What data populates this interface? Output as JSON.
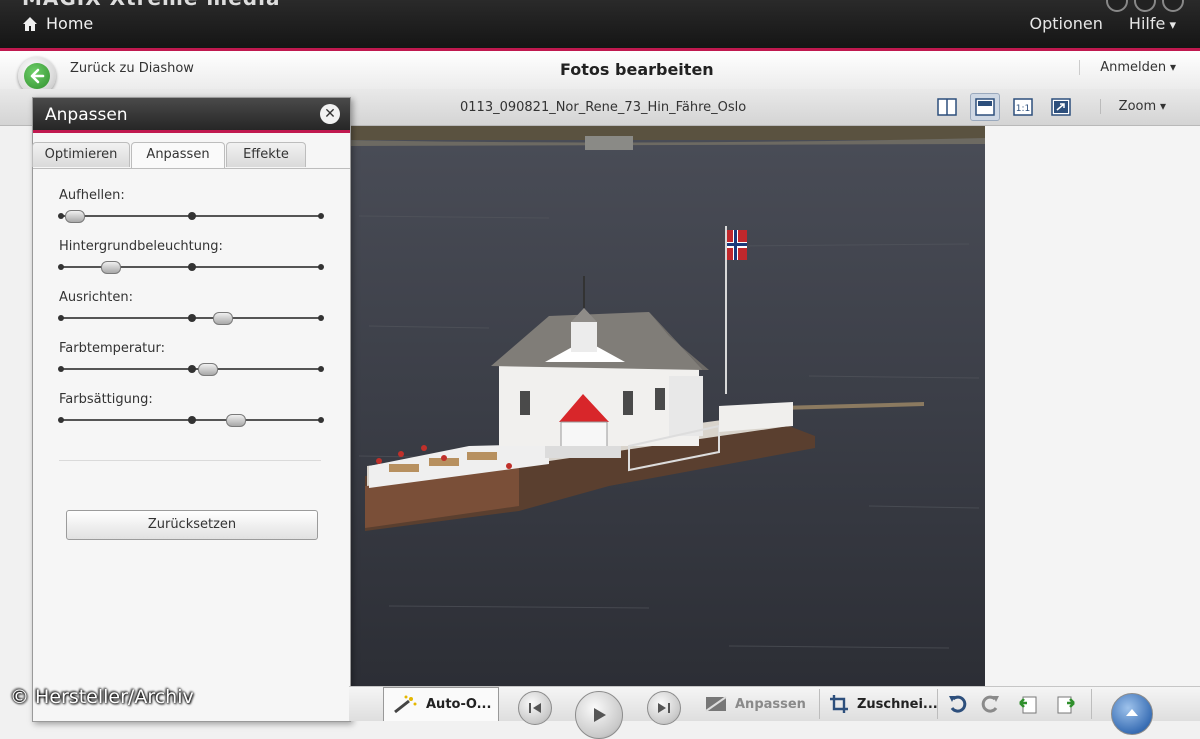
{
  "app": {
    "title_fragment": "MAGIX Xtreme media"
  },
  "topbar": {
    "home_label": "Home",
    "menu": [
      "Optionen",
      "Hilfe"
    ]
  },
  "subheader": {
    "back_label": "Zurück zu Diashow",
    "page_title": "Fotos bearbeiten",
    "login_label": "Anmelden"
  },
  "toolbar": {
    "filename": "0113_090821_Nor_Rene_73_Hin_Fähre_Oslo",
    "zoom_label": "Zoom",
    "view_buttons": [
      "single-view-icon",
      "filmstrip-view-icon",
      "actual-size-icon",
      "fit-window-icon"
    ]
  },
  "panel": {
    "title": "Anpassen",
    "tabs": [
      "Optimieren",
      "Anpassen",
      "Effekte"
    ],
    "active_tab": "Anpassen",
    "sliders": [
      {
        "label": "Aufhellen:",
        "value": 0.05
      },
      {
        "label": "Hintergrundbeleuchtung:",
        "value": 0.19
      },
      {
        "label": "Ausrichten:",
        "value": 0.62
      },
      {
        "label": "Farbtemperatur:",
        "value": 0.56
      },
      {
        "label": "Farbsättigung:",
        "value": 0.67
      }
    ],
    "reset_label": "Zurücksetzen"
  },
  "bottombar": {
    "auto_label": "Auto-O...",
    "anpassen_label": "Anpassen",
    "crop_label": "Zuschnei..."
  },
  "copyright": "© Hersteller/Archiv",
  "colors": {
    "accent": "#c0194f",
    "topbar": "#1c1c1c",
    "back_green": "#3c9a38"
  }
}
